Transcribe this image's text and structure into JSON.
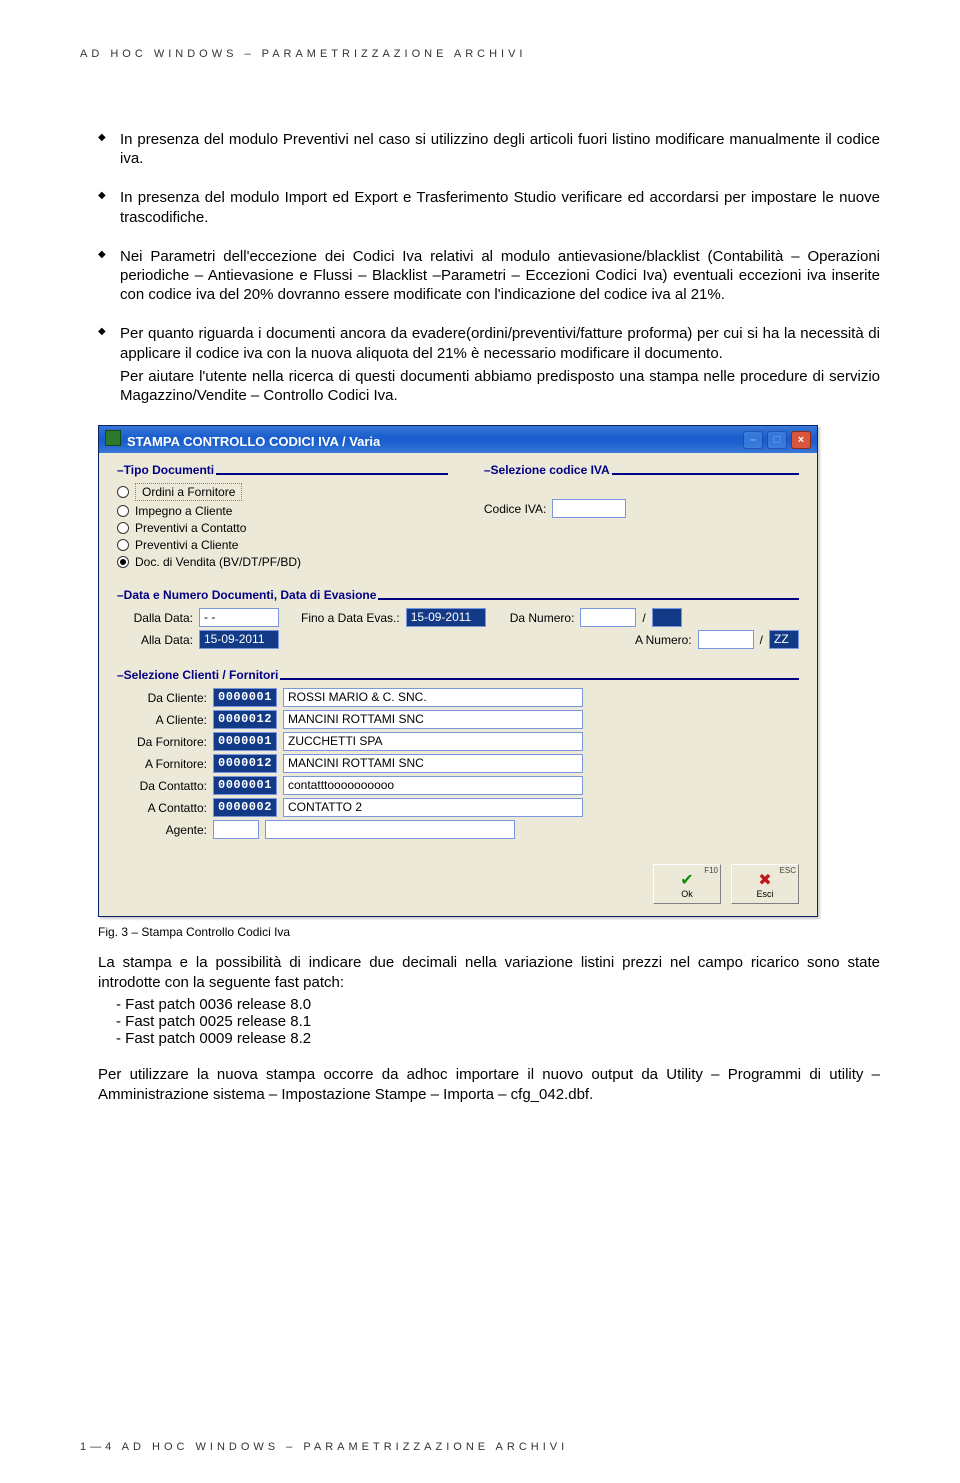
{
  "header": "AD HOC WINDOWS – PARAMETRIZZAZIONE ARCHIVI",
  "footer": "1—4   AD HOC WINDOWS – PARAMETRIZZAZIONE ARCHIVI",
  "bullets": {
    "b1": "In presenza del modulo Preventivi nel caso si utilizzino degli articoli fuori listino modificare manualmente il codice iva.",
    "b2": "In presenza del modulo Import ed Export e Trasferimento Studio verificare ed accordarsi per impostare le nuove trascodifiche.",
    "b3": "Nei Parametri dell'eccezione dei Codici Iva relativi al modulo antievasione/blacklist (Contabilità – Operazioni periodiche – Antievasione e Flussi – Blacklist –Parametri – Eccezioni Codici Iva) eventuali eccezioni iva inserite con codice iva del 20% dovranno essere modificate con l'indicazione del codice iva al 21%.",
    "b4a": "Per quanto riguarda i documenti ancora da evadere(ordini/preventivi/fatture proforma) per cui si ha la necessità di applicare il codice iva con la nuova aliquota del 21% è necessario modificare il documento.",
    "b4b": "Per aiutare l'utente nella ricerca di questi documenti abbiamo predisposto una stampa nelle procedure di servizio Magazzino/Vendite – Controllo Codici Iva."
  },
  "dialog": {
    "title": "STAMPA CONTROLLO CODICI IVA / Varia",
    "groups": {
      "tipoDoc": "–Tipo Documenti",
      "selIva": "–Selezione codice IVA",
      "dataNum": "–Data e Numero Documenti, Data di Evasione",
      "selCliFor": "–Selezione Clienti / Fornitori"
    },
    "radios": {
      "r1": "Ordini a Fornitore",
      "r2": "Impegno a Cliente",
      "r3": "Preventivi a Contatto",
      "r4": "Preventivi a Cliente",
      "r5": "Doc. di Vendita (BV/DT/PF/BD)"
    },
    "labels": {
      "codiceIva": "Codice IVA:",
      "dallaData": "Dalla Data:",
      "finoData": "Fino a Data Evas.:",
      "daNumero": "Da Numero:",
      "allaData": "Alla Data:",
      "aNumero": "A Numero:",
      "daCliente": "Da Cliente:",
      "aCliente": "A Cliente:",
      "daFornitore": "Da Fornitore:",
      "aFornitore": "A Fornitore:",
      "daContatto": "Da Contatto:",
      "aContatto": "A Contatto:",
      "agente": "Agente:",
      "slash": "/",
      "zz": "ZZ"
    },
    "values": {
      "dallaData": "- -",
      "finoData": "15-09-2011",
      "allaData": "15-09-2011",
      "daCliente_c": "0000001",
      "daCliente_n": "ROSSI MARIO & C. SNC.",
      "aCliente_c": "0000012",
      "aCliente_n": "MANCINI ROTTAMI SNC",
      "daForn_c": "0000001",
      "daForn_n": "ZUCCHETTI SPA",
      "aForn_c": "0000012",
      "aForn_n": "MANCINI ROTTAMI SNC",
      "daCont_c": "0000001",
      "daCont_n": "contatttoooooooooo",
      "aCont_c": "0000002",
      "aCont_n": "CONTATTO 2"
    },
    "buttons": {
      "okHot": "F10",
      "ok": "Ok",
      "escHot": "ESC",
      "esc": "Esci"
    }
  },
  "caption": "Fig. 3 – Stampa Controllo Codici Iva",
  "after": {
    "p1": "La stampa e la possibilità di indicare due decimali nella variazione listini prezzi nel campo ricarico sono state introdotte con la seguente fast patch:",
    "fp1": "Fast patch 0036  release 8.0",
    "fp2": "Fast patch 0025  release 8.1",
    "fp3": "Fast patch 0009  release 8.2",
    "p2": "Per utilizzare la nuova stampa occorre da adhoc importare il nuovo output da Utility – Programmi di utility – Amministrazione sistema – Impostazione Stampe – Importa – cfg_042.dbf."
  }
}
